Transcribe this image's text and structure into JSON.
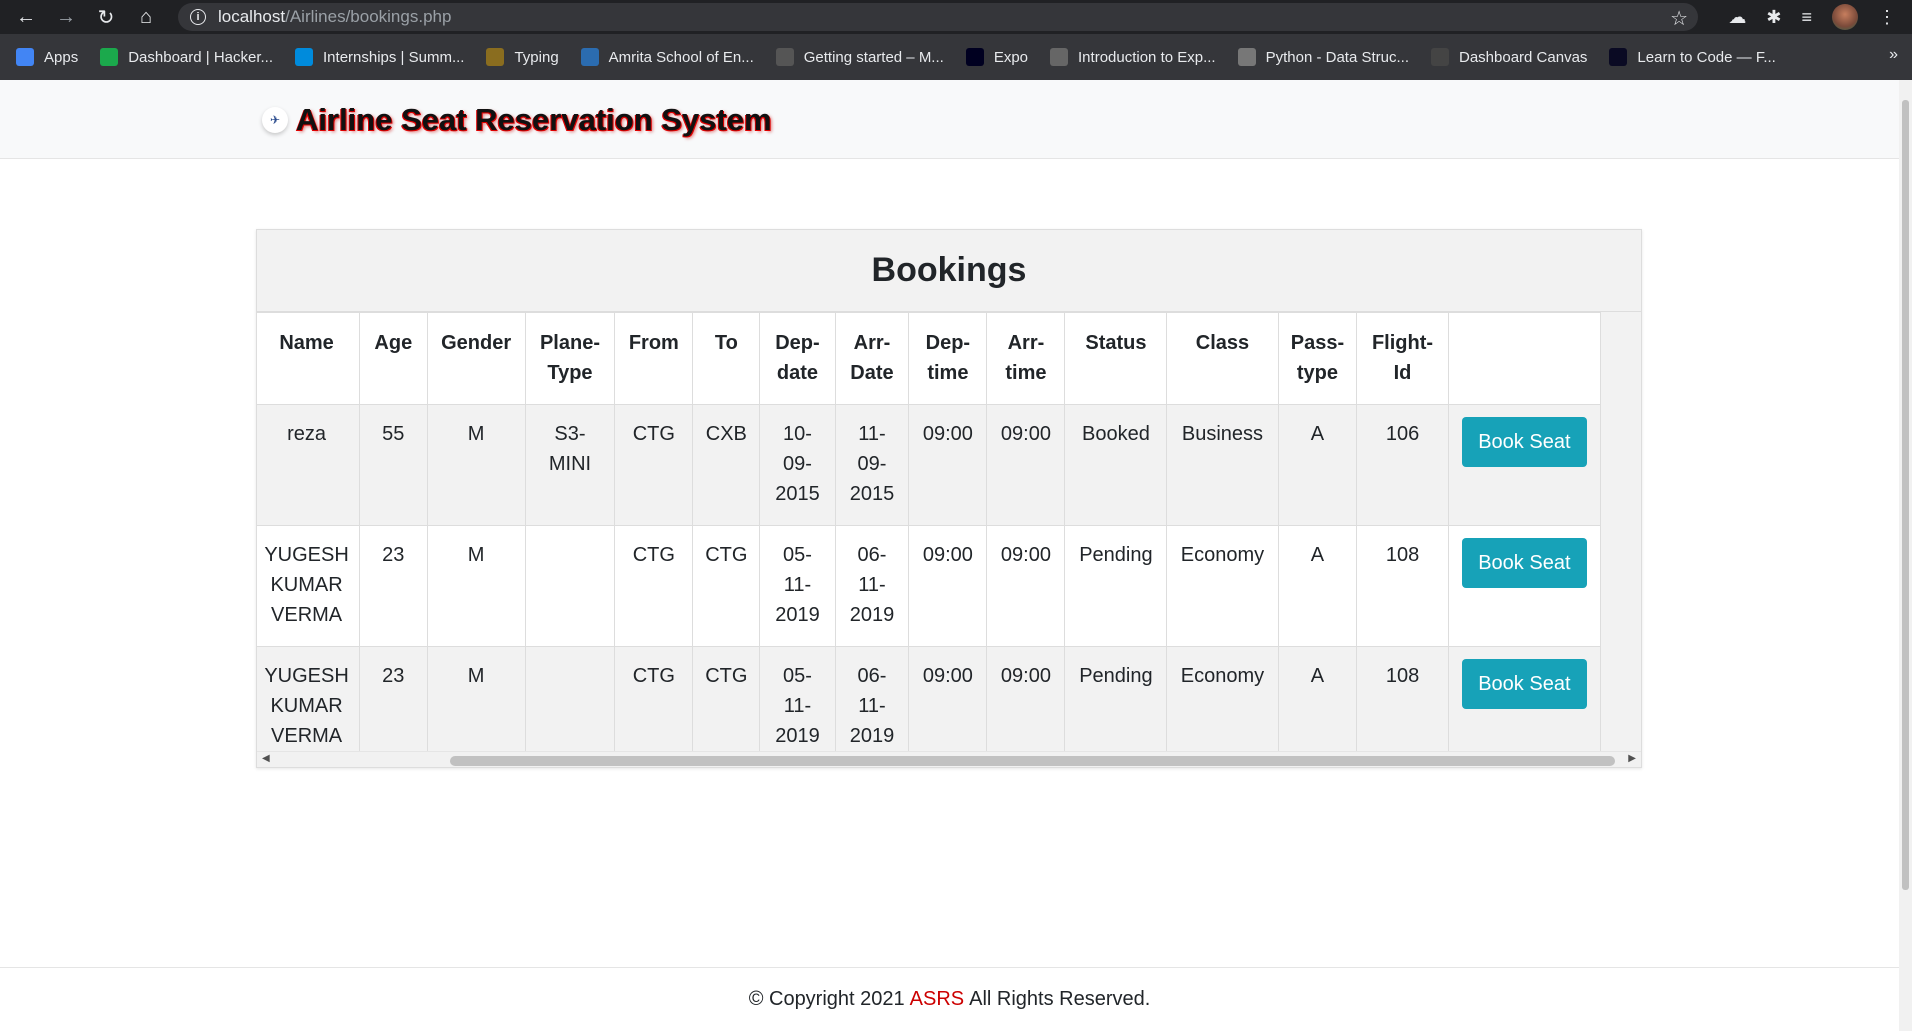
{
  "browser": {
    "url_host": "localhost",
    "url_path": "/Airlines/bookings.php",
    "bookmarks": [
      {
        "label": "Apps",
        "icon": "apps-grid-icon",
        "color": "#4285f4"
      },
      {
        "label": "Dashboard | Hacker...",
        "icon": "hackerrank-icon",
        "color": "#1ba94c"
      },
      {
        "label": "Internships | Summ...",
        "icon": "internshala-icon",
        "color": "#008bdc"
      },
      {
        "label": "Typing",
        "icon": "typing-icon",
        "color": "#8a6d1f"
      },
      {
        "label": "Amrita School of En...",
        "icon": "amrita-icon",
        "color": "#2b6cb0"
      },
      {
        "label": "Getting started – M...",
        "icon": "gear-icon",
        "color": "#555555"
      },
      {
        "label": "Expo",
        "icon": "expo-icon",
        "color": "#000020"
      },
      {
        "label": "Introduction to Exp...",
        "icon": "site-icon",
        "color": "#666666"
      },
      {
        "label": "Python - Data Struc...",
        "icon": "python-icon",
        "color": "#777777"
      },
      {
        "label": "Dashboard Canvas",
        "icon": "aws-icon",
        "color": "#444444"
      },
      {
        "label": "Learn to Code — F...",
        "icon": "freecodecamp-icon",
        "color": "#0a0a23"
      }
    ],
    "more_bookmarks": "»"
  },
  "navbar": {
    "title": "Airline Seat Reservation System"
  },
  "bookings": {
    "title": "Bookings",
    "columns": [
      "",
      "Name",
      "Age",
      "Gender",
      "Plane-Type",
      "From",
      "To",
      "Dep-date",
      "Arr-Date",
      "Dep-time",
      "Arr-time",
      "Status",
      "Class",
      "Pass-type",
      "Flight-Id",
      ""
    ],
    "rows": [
      {
        "id": "5",
        "name": "reza",
        "age": "55",
        "gender": "M",
        "plane_type": "S3-MINI",
        "from": "CTG",
        "to": "CXB",
        "dep_date": "10-09-2015",
        "arr_date": "11-09-2015",
        "dep_time": "09:00",
        "arr_time": "09:00",
        "status": "Booked",
        "class": "Business",
        "pass_type": "A",
        "flight_id": "106",
        "action": "Book Seat"
      },
      {
        "id": "9",
        "name": "YUGESH KUMAR VERMA",
        "age": "23",
        "gender": "M",
        "plane_type": "",
        "from": "CTG",
        "to": "CTG",
        "dep_date": "05-11-2019",
        "arr_date": "06-11-2019",
        "dep_time": "09:00",
        "arr_time": "09:00",
        "status": "Pending",
        "class": "Economy",
        "pass_type": "A",
        "flight_id": "108",
        "action": "Book Seat"
      },
      {
        "id": "9",
        "name": "YUGESH KUMAR VERMA",
        "age": "23",
        "gender": "M",
        "plane_type": "",
        "from": "CTG",
        "to": "CTG",
        "dep_date": "05-11-2019",
        "arr_date": "06-11-2019",
        "dep_time": "09:00",
        "arr_time": "09:00",
        "status": "Pending",
        "class": "Economy",
        "pass_type": "A",
        "flight_id": "108",
        "action": "Book Seat"
      }
    ]
  },
  "footer": {
    "prefix": "© Copyright 2021",
    "brand": "ASRS",
    "suffix": "All Rights Reserved."
  },
  "colors": {
    "accent_button": "#17a2b8",
    "brand_red": "#cc0000"
  }
}
